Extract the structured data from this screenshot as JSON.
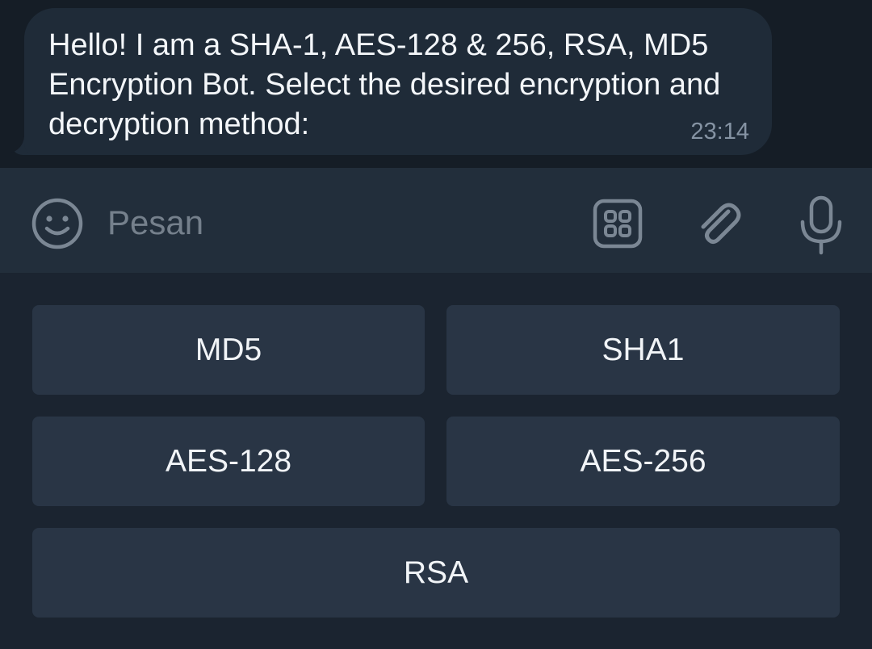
{
  "message": {
    "text": "Hello! I am a SHA-1, AES-128 & 256, RSA, MD5 Encryption Bot. Select the desired encryption and decryption method:",
    "time": "23:14"
  },
  "input": {
    "placeholder": "Pesan"
  },
  "icons": {
    "emoji": "emoji-icon",
    "keyboard": "bot-keyboard-icon",
    "attach": "paperclip-icon",
    "mic": "microphone-icon"
  },
  "keyboard": {
    "buttons": [
      "MD5",
      "SHA1",
      "AES-128",
      "AES-256",
      "RSA"
    ]
  },
  "colors": {
    "chat_bg": "#151d26",
    "bubble_bg": "#1f2b38",
    "input_bg": "#222e3b",
    "keyboard_bg": "#1b2430",
    "button_bg": "#293545",
    "text": "#f3f6f9",
    "muted": "#8593a3"
  }
}
